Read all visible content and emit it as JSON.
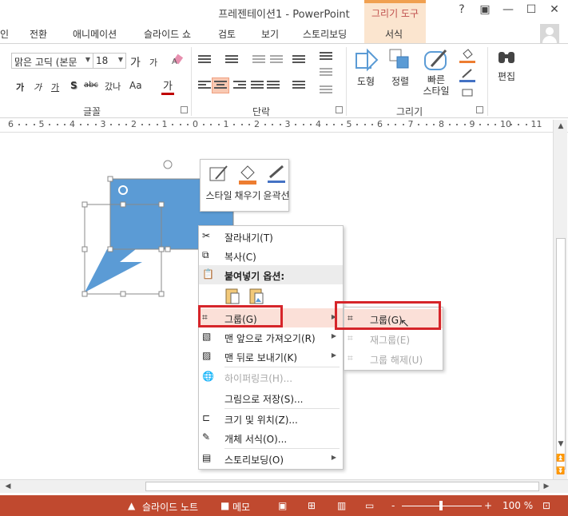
{
  "window": {
    "title": "프레젠테이션1 - PowerPoint",
    "context_tab_header": "그리기 도구",
    "controls": [
      "?",
      "▣",
      "—",
      "☐",
      "✕"
    ]
  },
  "tabs": [
    {
      "label": "인"
    },
    {
      "label": "전환"
    },
    {
      "label": "애니메이션"
    },
    {
      "label": "슬라이드 쇼"
    },
    {
      "label": "검토"
    },
    {
      "label": "보기"
    },
    {
      "label": "스토리보딩"
    },
    {
      "label": "서식"
    }
  ],
  "ribbon": {
    "font": {
      "name": "맑은 고딕 (본문",
      "size": "18",
      "group_label": "글꼴",
      "grow": "가",
      "shrink": "가",
      "bold": "가",
      "italic": "가",
      "underline": "가",
      "shadow": "S",
      "strike": "abc",
      "spacing": "갔나",
      "case": "Aa",
      "color": "가"
    },
    "paragraph": {
      "group_label": "단락"
    },
    "drawing": {
      "group_label": "그리기",
      "shape_label": "도형",
      "arrange_label": "정렬",
      "quick_style_label": "빠른\n스타일"
    },
    "editing": {
      "label": "편집"
    }
  },
  "ruler": {
    "numbers": [
      "6",
      "5",
      "4",
      "3",
      "2",
      "1",
      "0",
      "1",
      "2",
      "3",
      "4",
      "5",
      "6",
      "7",
      "8",
      "9",
      "10",
      "11"
    ]
  },
  "mini_toolbar": {
    "style": "스타일",
    "fill": "채우기",
    "outline": "윤곽선"
  },
  "context_menu": {
    "items": [
      {
        "label": "잘라내기(T)",
        "icon": "scissors-icon",
        "disabled": false
      },
      {
        "label": "복사(C)",
        "icon": "copy-icon",
        "disabled": false
      },
      {
        "label": "붙여넣기 옵션:",
        "icon": "paste-icon",
        "disabled": false
      },
      {
        "label": "그룹(G)",
        "icon": "group-icon",
        "disabled": false
      },
      {
        "label": "맨 앞으로 가져오기(R)",
        "icon": "bring-front-icon",
        "disabled": false
      },
      {
        "label": "맨 뒤로 보내기(K)",
        "icon": "send-back-icon",
        "disabled": false
      },
      {
        "label": "하이퍼링크(H)...",
        "icon": "hyperlink-icon",
        "disabled": true
      },
      {
        "label": "그림으로 저장(S)...",
        "icon": "",
        "disabled": false
      },
      {
        "label": "크기 및 위치(Z)...",
        "icon": "size-position-icon",
        "disabled": false
      },
      {
        "label": "개체 서식(O)...",
        "icon": "format-object-icon",
        "disabled": false
      },
      {
        "label": "스토리보딩(O)",
        "icon": "storyboard-icon",
        "disabled": false
      }
    ]
  },
  "submenu": {
    "items": [
      {
        "label": "그룹(G)",
        "disabled": false
      },
      {
        "label": "재그룹(E)",
        "disabled": true
      },
      {
        "label": "그룹 해제(U)",
        "disabled": true
      }
    ]
  },
  "status": {
    "notes": "슬라이드 노트",
    "comments": "메모",
    "zoom": "100 %",
    "zoom_minus": "-",
    "zoom_plus": "+"
  },
  "colors": {
    "accent": "#c0492f",
    "shape_fill": "#5b9bd5",
    "highlight_box": "#d6252a"
  }
}
